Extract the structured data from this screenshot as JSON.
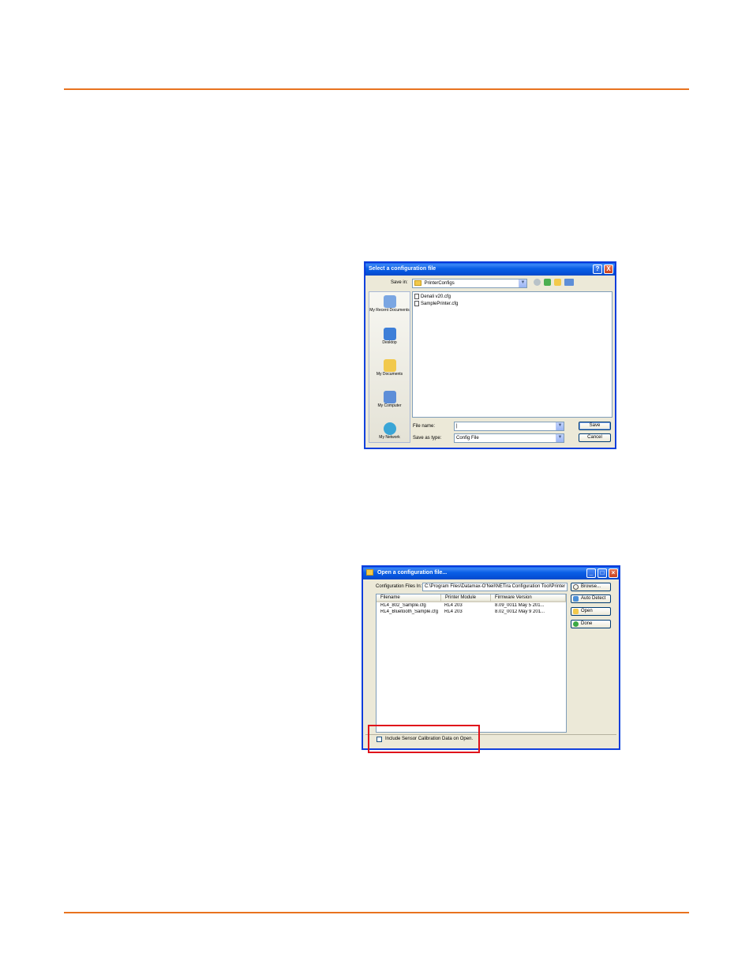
{
  "save_dialog": {
    "title": "Select a configuration file",
    "help_button": "?",
    "close_button": "X",
    "save_in_label": "Save in:",
    "save_in_value": "PrinterConfigs",
    "places": [
      {
        "name": "recent",
        "label": "My Recent Documents",
        "icon": "recent-documents-icon",
        "color": "#7aa6e2"
      },
      {
        "name": "desktop",
        "label": "Desktop",
        "icon": "desktop-icon",
        "color": "#3e7fd8"
      },
      {
        "name": "documents",
        "label": "My Documents",
        "icon": "documents-folder-icon",
        "color": "#f2c94c"
      },
      {
        "name": "computer",
        "label": "My Computer",
        "icon": "computer-icon",
        "color": "#5d8ed8"
      },
      {
        "name": "network",
        "label": "My Network",
        "icon": "network-icon",
        "color": "#3aa5d6"
      }
    ],
    "files": [
      "Denali v20.cfg",
      "SamplePrinter.cfg"
    ],
    "file_name_label": "File name:",
    "file_name_value": "|",
    "save_type_label": "Save as type:",
    "save_type_value": "Config File",
    "save_button": "Save",
    "cancel_button": "Cancel"
  },
  "open_dialog": {
    "title": "Open a configuration file...",
    "path_label": "Configuration Files In:",
    "path_value": "C:\\Program Files\\Datamax-O'Neil\\NETira Configuration Tool\\Printer",
    "columns": [
      "Filename",
      "Printer Module",
      "Firmware Version"
    ],
    "rows": [
      [
        "RL4_802_Sample.cfg",
        "RL4 203",
        "8.09_0011 May  5 201..."
      ],
      [
        "RL4_Bluetooth_Sample.cfg",
        "RL4 203",
        "8.02_0012 May  9 201..."
      ]
    ],
    "buttons": {
      "browse": "Browse...",
      "auto_detect": "Auto Detect",
      "open": "Open",
      "done": "Done"
    },
    "checkbox_label": "Include Sensor Calibration Data on Open.",
    "checkbox_checked": false
  },
  "colors": {
    "accent_rule": "#e8731f",
    "highlight": "#e0101a"
  }
}
